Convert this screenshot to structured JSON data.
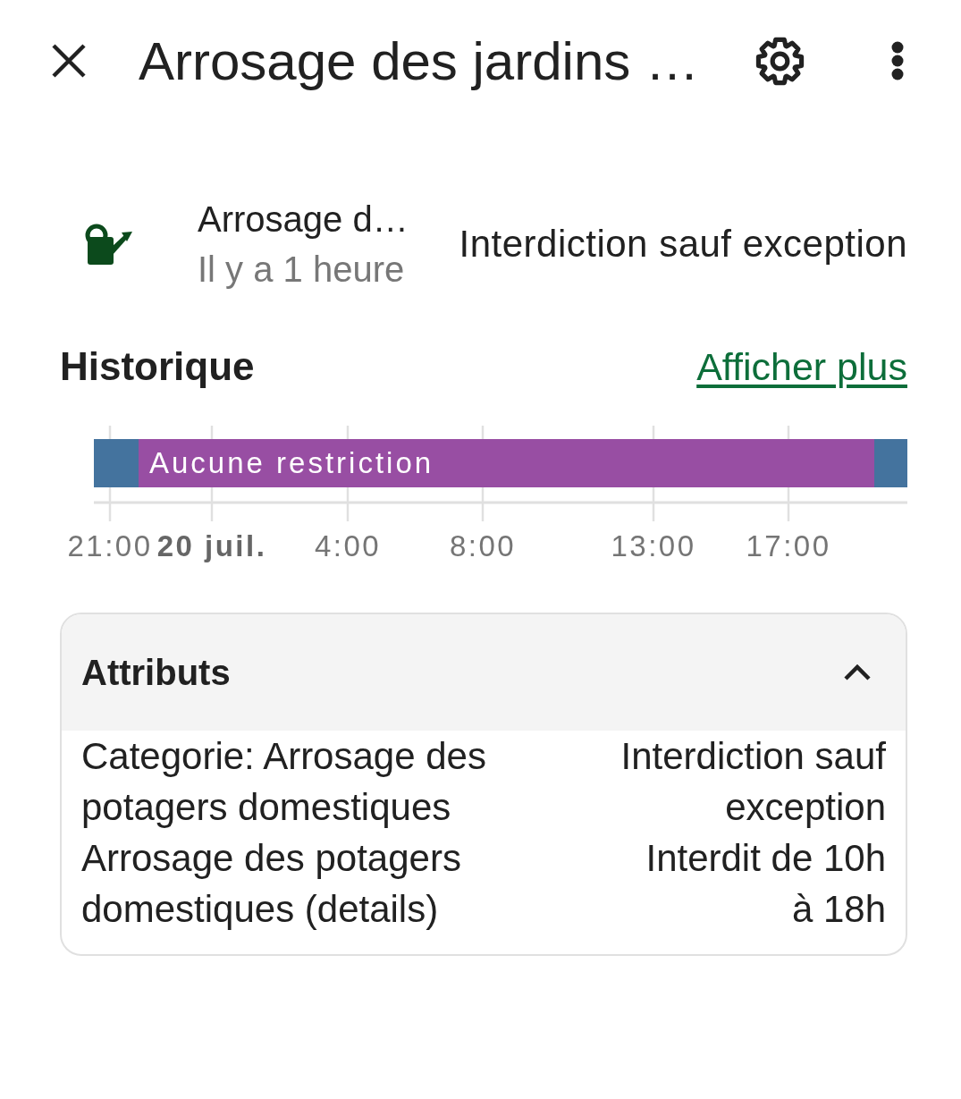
{
  "header": {
    "title": "Arrosage des jardins …"
  },
  "entity": {
    "name": "Arrosage d…",
    "last_changed": "Il y a 1 heure",
    "state": "Interdiction sauf exception"
  },
  "history": {
    "title": "Historique",
    "link": "Afficher plus",
    "timeline": {
      "segments": [
        {
          "color": "#44739e"
        },
        {
          "label": "Aucune restriction",
          "color": "#984ea3"
        },
        {
          "color": "#44739e"
        }
      ],
      "axis_labels": [
        {
          "label": "21:00",
          "kind": "time"
        },
        {
          "label": "20 juil.",
          "kind": "date"
        },
        {
          "label": "4:00",
          "kind": "time"
        },
        {
          "label": "8:00",
          "kind": "time"
        },
        {
          "label": "13:00",
          "kind": "time"
        },
        {
          "label": "17:00",
          "kind": "time"
        }
      ]
    }
  },
  "attributes": {
    "title": "Attributs",
    "expanded": true,
    "rows": [
      {
        "key": "Categorie: Arrosage des potagers domestiques",
        "value": "Interdiction sauf exception"
      },
      {
        "key": "Arrosage des potagers domestiques (details)",
        "value": "Interdit de 10h à 18h"
      }
    ]
  }
}
